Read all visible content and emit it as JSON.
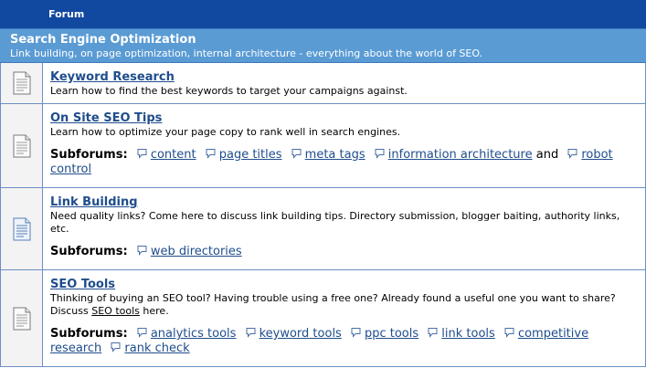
{
  "header": {
    "forum_col": "Forum"
  },
  "category": {
    "title": "Search Engine Optimization",
    "description": "Link building, on page optimization, internal architecture - everything about the world of SEO."
  },
  "forums": [
    {
      "title": "Keyword Research",
      "description": "Learn how to find the best keywords to target your campaigns against."
    },
    {
      "title": "On Site SEO Tips",
      "description": "Learn how to optimize your page copy to rank well in search engines.",
      "subforums_label": "Subforums:",
      "subforums": [
        "content",
        "page titles",
        "meta tags",
        "information architecture",
        "robot control"
      ],
      "and_word": "and"
    },
    {
      "title": "Link Building",
      "description": "Need quality links? Come here to discuss link building tips. Directory submission, blogger baiting, authority links, etc.",
      "subforums_label": "Subforums:",
      "subforums": [
        "web directories"
      ]
    },
    {
      "title": "SEO Tools",
      "description_before": "Thinking of buying an SEO tool? Having trouble using a free one? Already found a useful one you want to share? Discuss ",
      "description_link": "SEO tools",
      "description_after": " here.",
      "subforums_label": "Subforums:",
      "subforums": [
        "analytics tools",
        "keyword tools",
        "ppc tools",
        "link tools",
        "competitive research",
        "rank check"
      ]
    }
  ],
  "icons": {
    "forum": "document-icon",
    "subforum": "speech-bubble-icon"
  },
  "colors": {
    "header_bg": "#1149a0",
    "category_bg": "#5a9bd4",
    "link": "#1f4d8c"
  }
}
